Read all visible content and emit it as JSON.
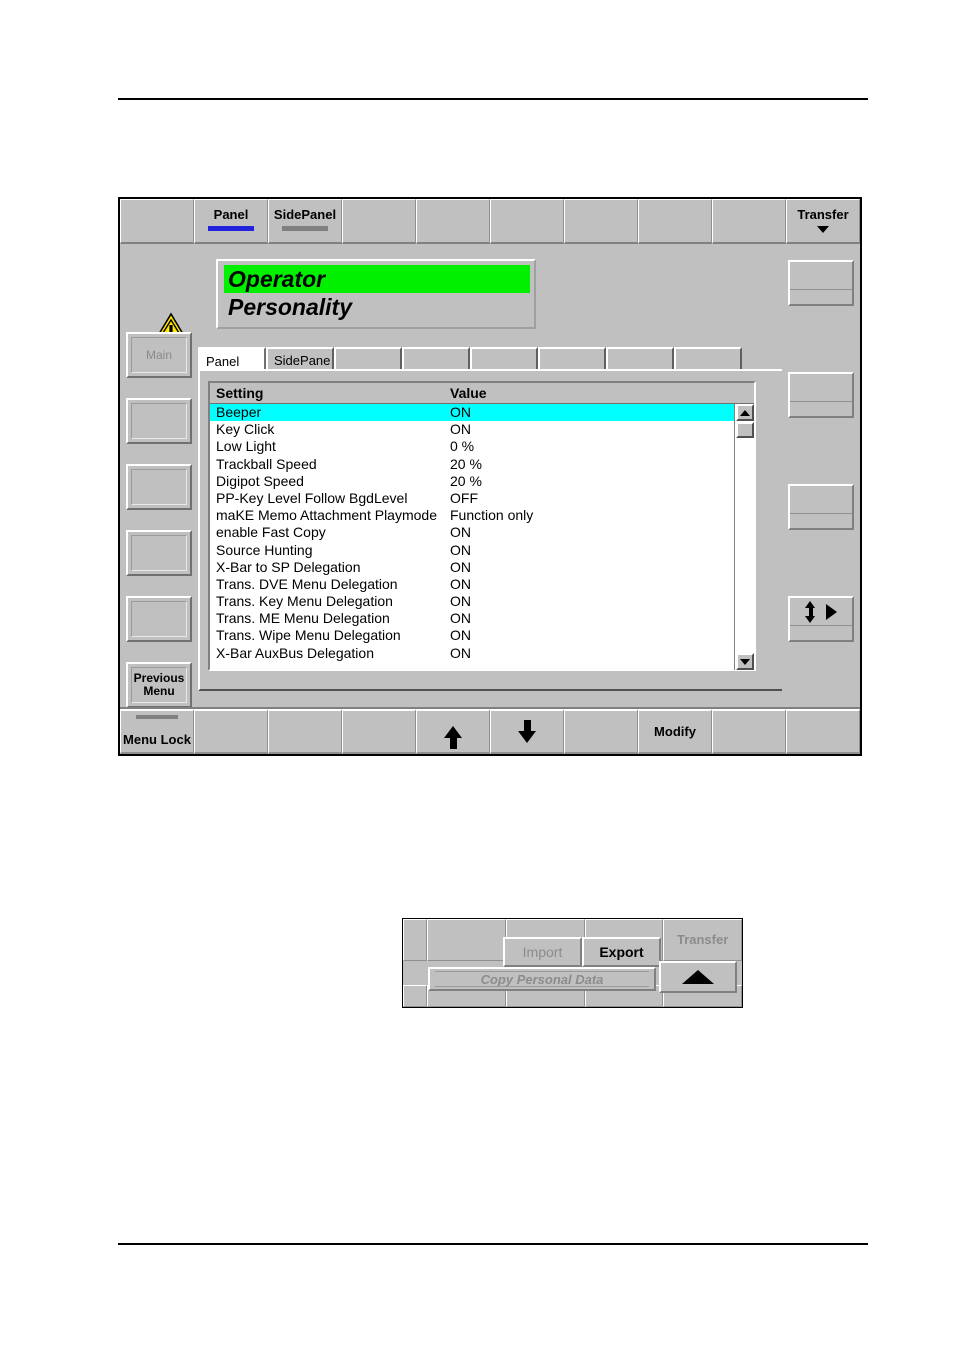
{
  "device": {
    "top_bar": {
      "cells": [
        {
          "label": "",
          "underline": "none"
        },
        {
          "label": "Panel",
          "underline": "blue"
        },
        {
          "label": "SidePanel",
          "underline": "gray"
        },
        {
          "label": "",
          "underline": "none"
        },
        {
          "label": "",
          "underline": "none"
        },
        {
          "label": "",
          "underline": "none"
        },
        {
          "label": "",
          "underline": "none"
        },
        {
          "label": "",
          "underline": "none"
        },
        {
          "label": "",
          "underline": "none"
        },
        {
          "label": "Transfer",
          "underline": "none",
          "caret": "chevron-down-icon"
        }
      ]
    },
    "left_column": {
      "warning_icon": "warning-triangle-icon",
      "buttons": [
        {
          "label": "Main",
          "state": "dim"
        },
        {
          "label": "",
          "state": "dim"
        },
        {
          "label": "",
          "state": "dim"
        },
        {
          "label": "",
          "state": "dim"
        },
        {
          "label": "",
          "state": "dim"
        },
        {
          "label": "Previous Menu",
          "state": "strong"
        }
      ]
    },
    "title": {
      "line1": "Operator",
      "line2": "Personality",
      "highlight_color": "#00f000"
    },
    "dialog": {
      "tabs": [
        {
          "label": "Panel",
          "active": true
        },
        {
          "label": "SidePane",
          "active": false
        },
        {
          "label": "",
          "active": false
        },
        {
          "label": "",
          "active": false
        },
        {
          "label": "",
          "active": false
        },
        {
          "label": "",
          "active": false
        },
        {
          "label": "",
          "active": false
        },
        {
          "label": "",
          "active": false
        }
      ],
      "list": {
        "columns": [
          "Setting",
          "Value"
        ],
        "selected_index": 0,
        "selection_color": "#00ffff",
        "rows": [
          {
            "setting": "Beeper",
            "value": "ON"
          },
          {
            "setting": "Key Click",
            "value": "ON"
          },
          {
            "setting": "Low Light",
            "value": "0 %"
          },
          {
            "setting": "Trackball Speed",
            "value": "20 %"
          },
          {
            "setting": "Digipot Speed",
            "value": "20 %"
          },
          {
            "setting": "PP-Key Level Follow BgdLevel",
            "value": "OFF"
          },
          {
            "setting": "maKE Memo Attachment Playmode",
            "value": "Function only"
          },
          {
            "setting": "enable Fast Copy",
            "value": "ON"
          },
          {
            "setting": "Source Hunting",
            "value": "ON"
          },
          {
            "setting": "X-Bar to SP Delegation",
            "value": "ON"
          },
          {
            "setting": "Trans. DVE Menu Delegation",
            "value": "ON"
          },
          {
            "setting": "Trans. Key Menu Delegation",
            "value": "ON"
          },
          {
            "setting": "Trans. ME Menu Delegation",
            "value": "ON"
          },
          {
            "setting": "Trans. Wipe Menu Delegation",
            "value": "ON"
          },
          {
            "setting": "X-Bar AuxBus Delegation",
            "value": "ON"
          }
        ]
      },
      "scrollbar": {
        "up_icon": "scroll-up-arrow-icon",
        "down_icon": "scroll-down-arrow-icon"
      }
    },
    "right_column": {
      "buttons": [
        {
          "label": "",
          "icon": ""
        },
        {
          "label": "",
          "icon": ""
        },
        {
          "label": "",
          "icon": ""
        },
        {
          "label": "",
          "icon": "updown-right-icon"
        }
      ]
    },
    "bottom_bar": {
      "cells": [
        {
          "label": "Menu Lock",
          "mark": true,
          "icon": ""
        },
        {
          "label": "",
          "mark": false,
          "icon": ""
        },
        {
          "label": "",
          "mark": false,
          "icon": ""
        },
        {
          "label": "",
          "mark": false,
          "icon": ""
        },
        {
          "label": "",
          "mark": false,
          "icon": "arrow-up-icon"
        },
        {
          "label": "",
          "mark": false,
          "icon": "arrow-down-icon"
        },
        {
          "label": "",
          "mark": false,
          "icon": ""
        },
        {
          "label": "Modify",
          "mark": false,
          "icon": ""
        },
        {
          "label": "",
          "mark": false,
          "icon": ""
        },
        {
          "label": "",
          "mark": false,
          "icon": ""
        }
      ]
    }
  },
  "popup": {
    "top_cells": [
      {
        "label": ""
      },
      {
        "label": ""
      },
      {
        "label": ""
      },
      {
        "label": ""
      },
      {
        "label": "Transfer"
      }
    ],
    "import_label": "Import",
    "export_label": "Export",
    "copy_label": "Copy Personal Data",
    "up_caret_icon": "chevron-up-icon"
  }
}
